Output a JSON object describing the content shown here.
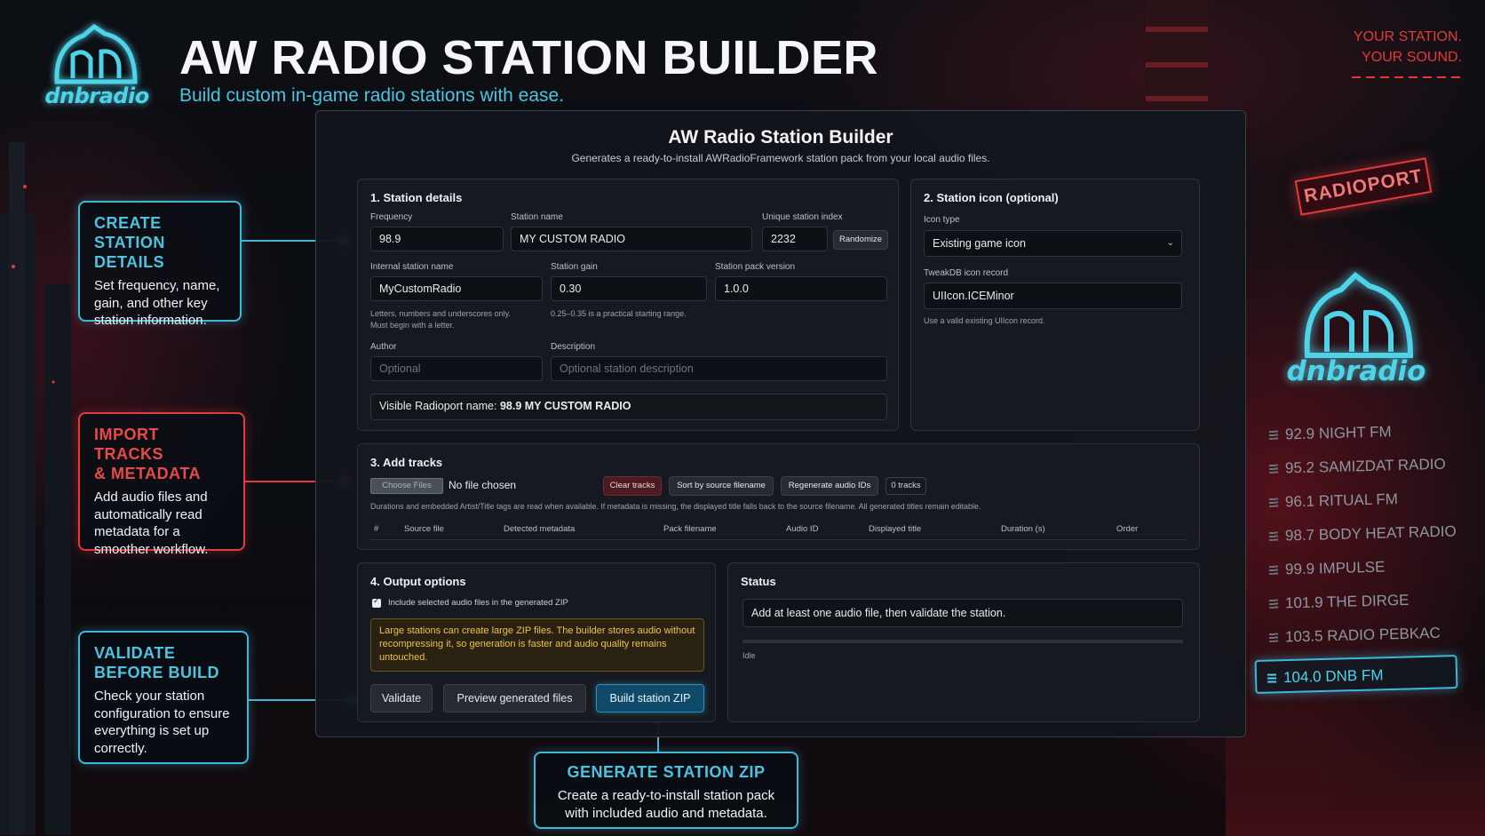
{
  "header": {
    "logo_text": "dnbradio",
    "title": "AW RADIO STATION BUILDER",
    "subtitle": "Build custom in-game radio stations with ease.",
    "slogan_line1": "YOUR STATION.",
    "slogan_line2": "YOUR SOUND."
  },
  "callouts": {
    "details": {
      "title_line1": "CREATE STATION",
      "title_line2": "DETAILS",
      "text": "Set frequency, name, gain, and other key station information."
    },
    "import": {
      "title_line1": "IMPORT TRACKS",
      "title_line2": "& METADATA",
      "text": "Add audio files and automatically read metadata for a smoother workflow."
    },
    "validate": {
      "title_line1": "VALIDATE",
      "title_line2": "BEFORE BUILD",
      "text": "Check your station configuration to ensure everything is set up correctly."
    },
    "generate": {
      "title": "GENERATE STATION ZIP",
      "text": "Create a ready-to-install station pack with included audio and metadata."
    }
  },
  "panel": {
    "title": "AW Radio Station Builder",
    "subtitle": "Generates a ready-to-install AWRadioFramework station pack from your local audio files."
  },
  "station_details": {
    "title": "1. Station details",
    "frequency_label": "Frequency",
    "frequency_value": "98.9",
    "name_label": "Station name",
    "name_value": "MY CUSTOM RADIO",
    "index_label": "Unique station index",
    "index_value": "2232",
    "randomize_label": "Randomize",
    "internal_label": "Internal station name",
    "internal_value": "MyCustomRadio",
    "internal_hint_1": "Letters, numbers and underscores only.",
    "internal_hint_2": "Must begin with a letter.",
    "gain_label": "Station gain",
    "gain_value": "0.30",
    "gain_hint": "0.25–0.35 is a practical starting range.",
    "version_label": "Station pack version",
    "version_value": "1.0.0",
    "author_label": "Author",
    "author_placeholder": "Optional",
    "description_label": "Description",
    "description_placeholder": "Optional station description",
    "visible_prefix": "Visible Radioport name:",
    "visible_value": "98.9 MY CUSTOM RADIO"
  },
  "station_icon": {
    "title": "2. Station icon (optional)",
    "type_label": "Icon type",
    "type_value": "Existing game icon",
    "record_label": "TweakDB icon record",
    "record_value": "UIIcon.ICEMinor",
    "record_hint": "Use a valid existing UIIcon record."
  },
  "tracks": {
    "title": "3. Add tracks",
    "choose_label": "Choose Files",
    "no_file_text": "No file chosen",
    "clear_label": "Clear tracks",
    "sort_label": "Sort by source filename",
    "regen_label": "Regenerate audio IDs",
    "count_label": "0 tracks",
    "note": "Durations and embedded Artist/Title tags are read when available. If metadata is missing, the displayed title falls back to the source filename. All generated titles remain editable.",
    "columns": [
      "#",
      "Source file",
      "Detected metadata",
      "Pack filename",
      "Audio ID",
      "Displayed title",
      "Duration (s)",
      "Order"
    ]
  },
  "output": {
    "title": "4. Output options",
    "include_label": "Include selected audio files in the generated ZIP",
    "include_checked": true,
    "warning": "Large stations can create large ZIP files. The builder stores audio without recompressing it, so generation is faster and audio quality remains untouched.",
    "validate_label": "Validate",
    "preview_label": "Preview generated files",
    "build_label": "Build station ZIP"
  },
  "status": {
    "title": "Status",
    "message": "Add at least one audio file, then validate the station.",
    "progress": 0,
    "state": "Idle"
  },
  "sidebar": {
    "radioport_label": "RADIOPORT",
    "logo_text": "dnbradio",
    "stations": [
      {
        "label": "92.9 NIGHT FM",
        "active": false
      },
      {
        "label": "95.2 SAMIZDAT RADIO",
        "active": false
      },
      {
        "label": "96.1 RITUAL FM",
        "active": false
      },
      {
        "label": "98.7 BODY HEAT RADIO",
        "active": false
      },
      {
        "label": "99.9 IMPULSE",
        "active": false
      },
      {
        "label": "101.9 THE DIRGE",
        "active": false
      },
      {
        "label": "103.5 RADIO PEBKAC",
        "active": false
      },
      {
        "label": "104.0 DNB FM",
        "active": true
      }
    ]
  },
  "colors": {
    "accent": "#3fb8d8",
    "danger": "#e23b3b",
    "warning": "#f0c24a"
  }
}
